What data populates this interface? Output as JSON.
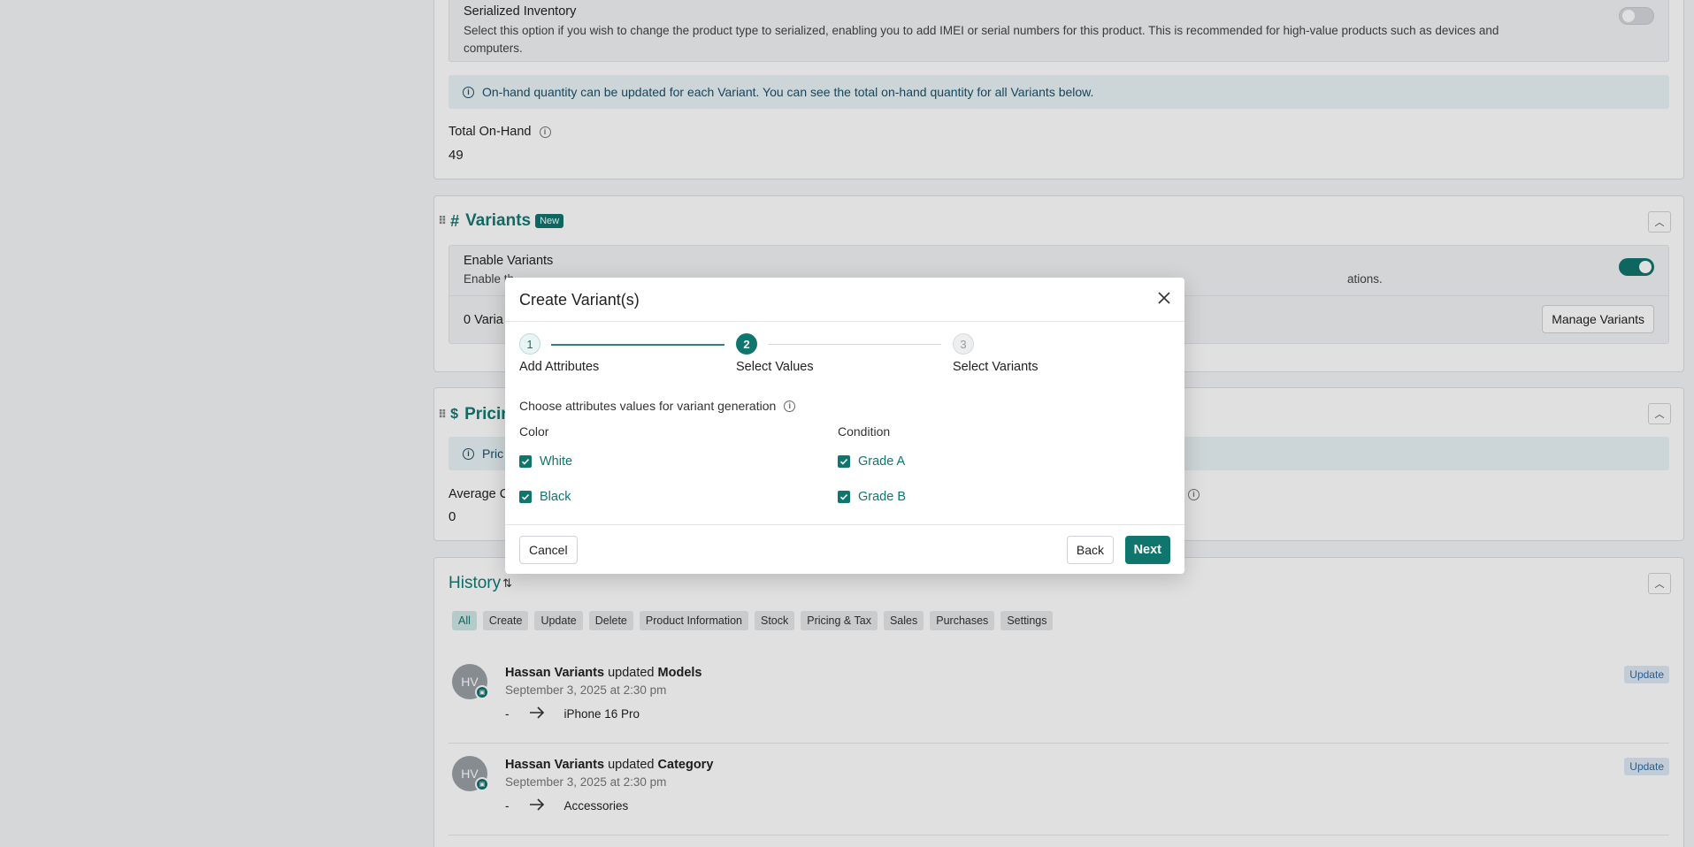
{
  "serialized": {
    "title": "Serialized Inventory",
    "description": "Select this option if you wish to change the product type to serialized, enabling you to add IMEI or serial numbers for this product. This is recommended for high-value products such as devices and computers.",
    "toggle_on": false
  },
  "onhand_info": "On-hand quantity can be updated for each Variant. You can see the total on-hand quantity for all Variants below.",
  "total_onhand": {
    "label": "Total On-Hand",
    "value": "49"
  },
  "variants_section": {
    "title": "Variants",
    "badge": "New",
    "enable_title": "Enable Variants",
    "enable_desc_start": "Enable th",
    "enable_desc_end": "ations.",
    "count_text": "0 Varia",
    "manage_button": "Manage Variants",
    "toggle_on": true
  },
  "pricing_section": {
    "title": "Pricin",
    "info": "Pric",
    "avg_label": "Average C",
    "avg_value": "0"
  },
  "history": {
    "title": "History",
    "filters": [
      "All",
      "Create",
      "Update",
      "Delete",
      "Product Information",
      "Stock",
      "Pricing & Tax",
      "Sales",
      "Purchases",
      "Settings"
    ],
    "active_filter": "All",
    "items": [
      {
        "initials": "HV",
        "user": "Hassan Variants",
        "action": "updated",
        "field": "Models",
        "time": "September 3, 2025 at 2:30 pm",
        "from": "-",
        "to": "iPhone 16 Pro",
        "badge": "Update"
      },
      {
        "initials": "HV",
        "user": "Hassan Variants",
        "action": "updated",
        "field": "Category",
        "time": "September 3, 2025 at 2:30 pm",
        "from": "-",
        "to": "Accessories",
        "badge": "Update"
      }
    ]
  },
  "modal": {
    "title": "Create Variant(s)",
    "steps": [
      {
        "number": "1",
        "label": "Add Attributes",
        "state": "done"
      },
      {
        "number": "2",
        "label": "Select Values",
        "state": "active"
      },
      {
        "number": "3",
        "label": "Select Variants",
        "state": "todo"
      }
    ],
    "choose_label": "Choose attributes values for variant generation",
    "attributes": [
      {
        "name": "Color",
        "values": [
          {
            "label": "White",
            "checked": true
          },
          {
            "label": "Black",
            "checked": true
          }
        ]
      },
      {
        "name": "Condition",
        "values": [
          {
            "label": "Grade A",
            "checked": true
          },
          {
            "label": "Grade B",
            "checked": true
          }
        ]
      }
    ],
    "cancel_label": "Cancel",
    "back_label": "Back",
    "next_label": "Next"
  },
  "colors": {
    "accent": "#0f766e",
    "info_bg": "#e9f3f5"
  }
}
